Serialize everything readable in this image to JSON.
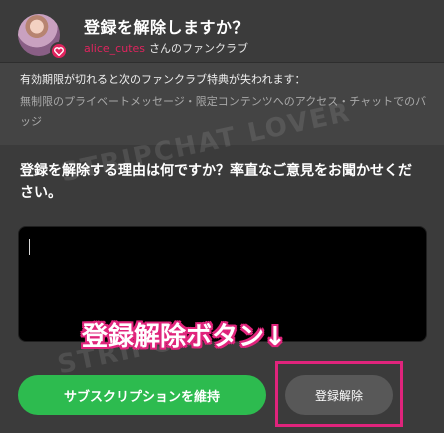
{
  "header": {
    "title": "登録を解除しますか？",
    "username": "alice_cutes",
    "club_suffix": "さんのファンクラブ"
  },
  "losing": {
    "heading": "有効期限が切れると次のファンクラブ特典が失われます：",
    "benefits": "無制限のプライベートメッセージ・限定コンテンツへのアクセス・チャットでのバッジ"
  },
  "reason": {
    "question": "登録を解除する理由は何ですか？率直なご意見をお聞かせください。",
    "input_value": ""
  },
  "watermarks": [
    "STRIPCHAT LOVER",
    "STRIPCHAT LOVER"
  ],
  "annotation": {
    "text": "登録解除ボタン↓",
    "color": "#e0247c"
  },
  "buttons": {
    "keep_label": "サブスクリプションを維持",
    "unsubscribe_label": "登録解除"
  },
  "colors": {
    "accent_green": "#2dbb4f",
    "username_pink": "#e0245e",
    "highlight_pink": "#e0247c"
  },
  "icons": {
    "avatar_badge": "heart-icon"
  }
}
